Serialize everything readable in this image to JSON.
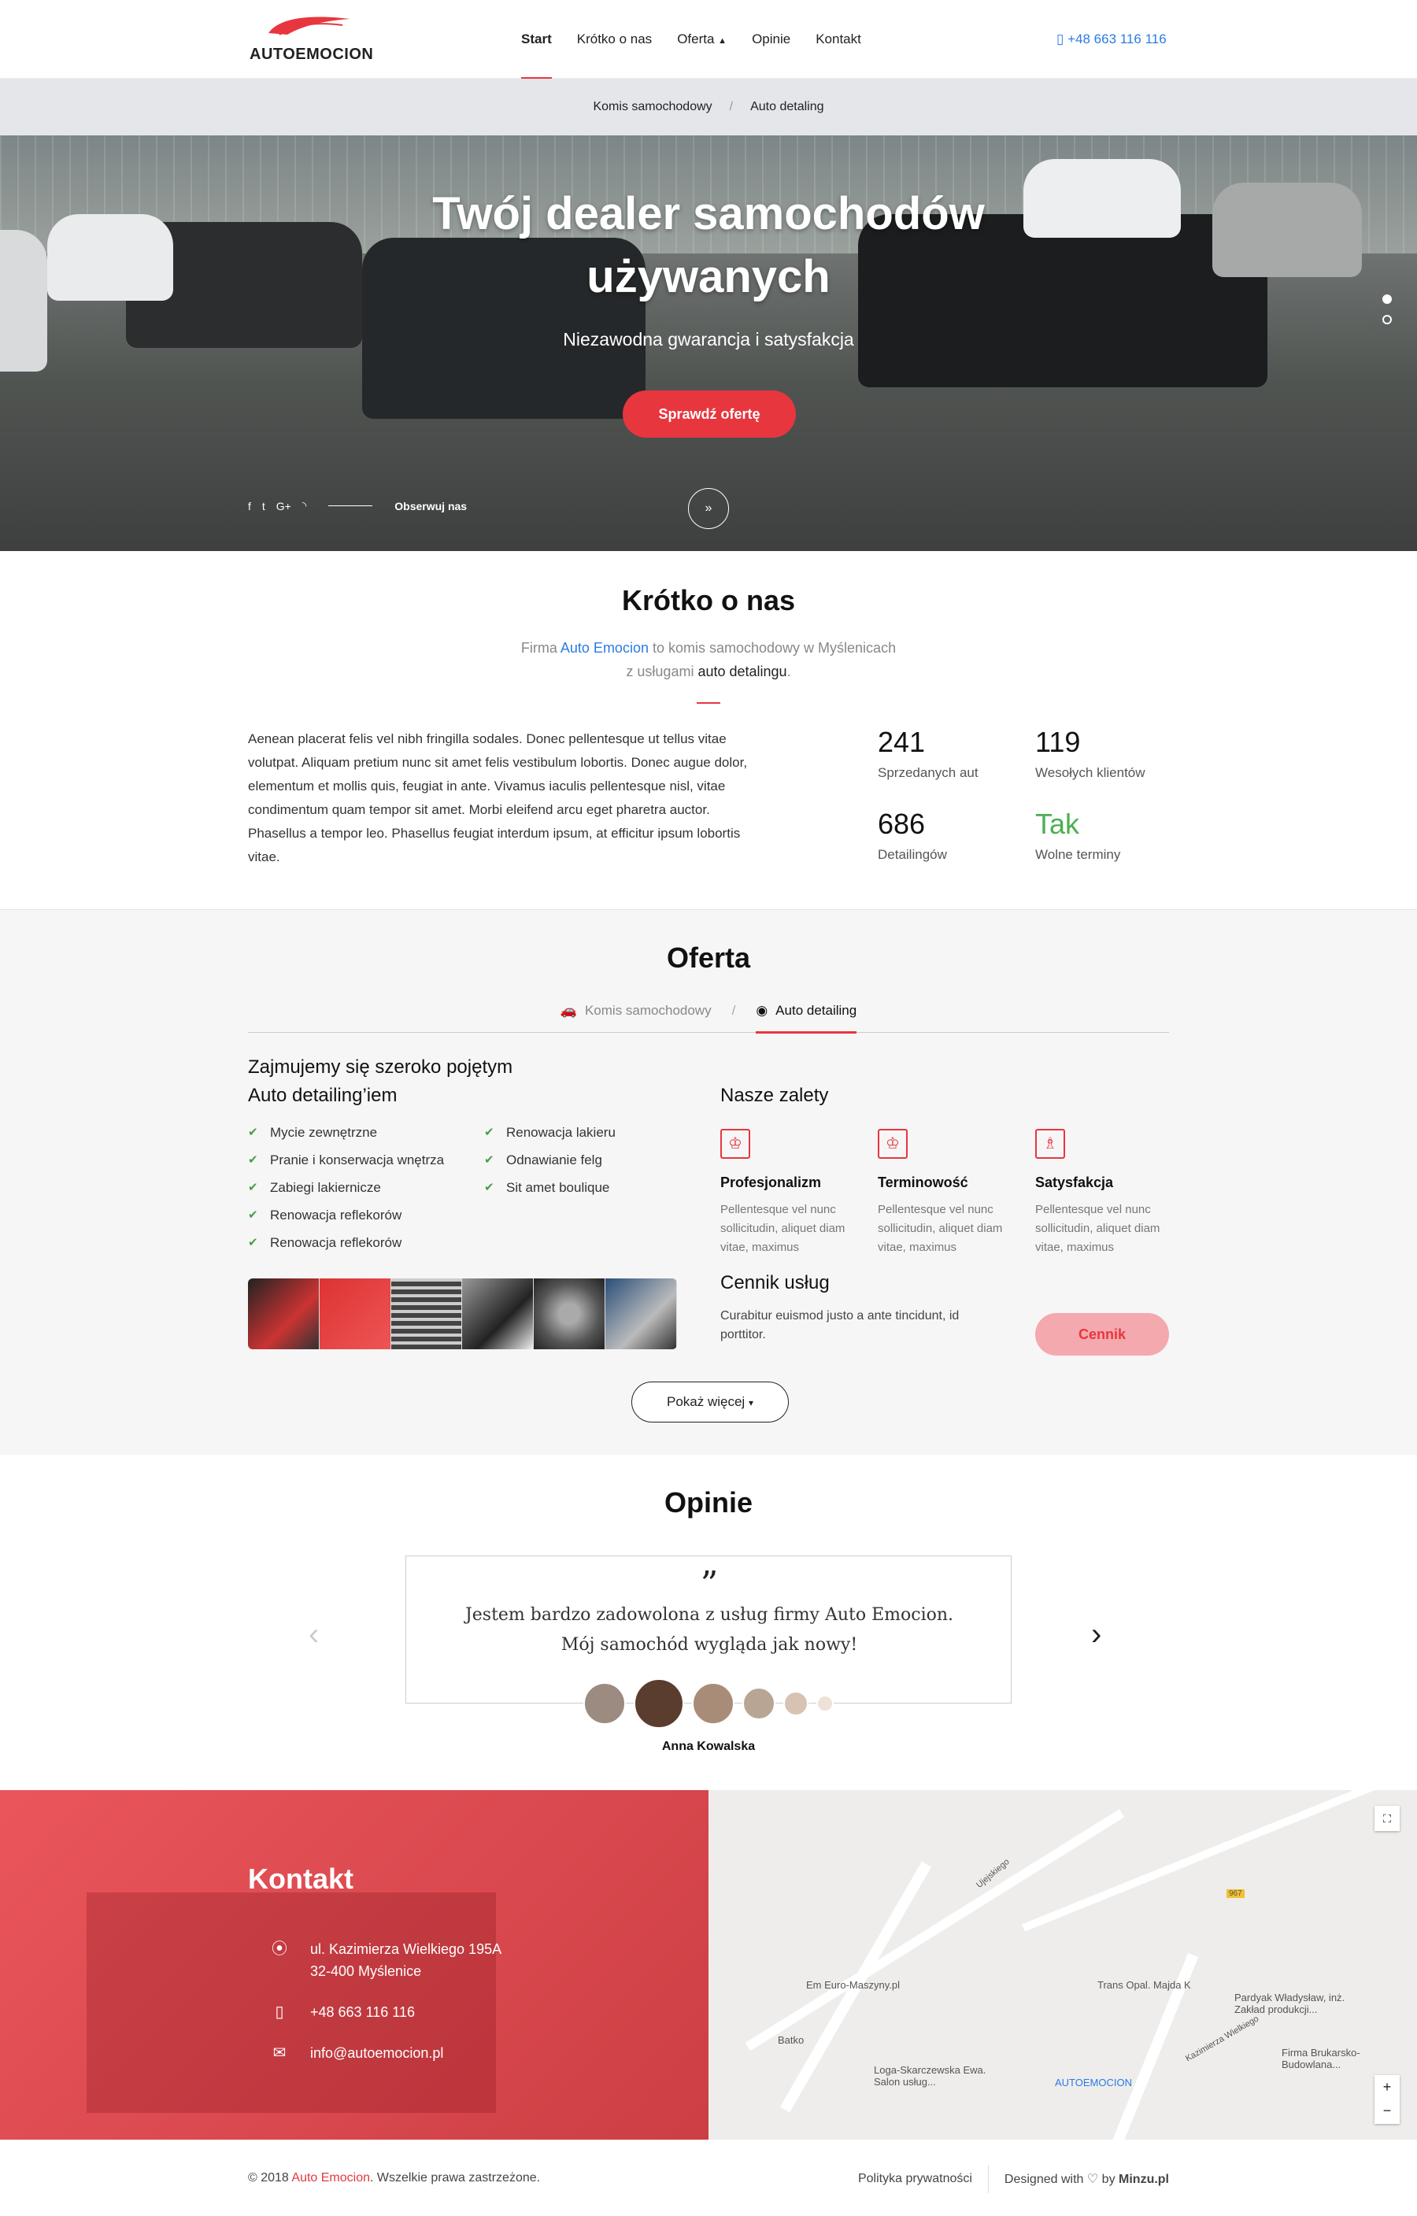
{
  "brand": {
    "name": "AUTOEMOCION",
    "accent": "#e8363f",
    "link": "#2a7be4"
  },
  "nav": {
    "items": [
      "Start",
      "Krótko o nas",
      "Oferta",
      "Opinie",
      "Kontakt"
    ],
    "active": "Start",
    "oferta_caret": "chevron-up-icon",
    "phone": "+48 663 116 116"
  },
  "crumbs": [
    "Komis samochodowy",
    "/",
    "Auto detaling"
  ],
  "hero": {
    "title_line1": "Twój dealer samochodów",
    "title_line2": "używanych",
    "subtitle": "Niezawodna gwarancja i satysfakcja",
    "cta": "Sprawdź ofertę",
    "follow": "Obserwuj nas",
    "social_icons": [
      "facebook-icon",
      "twitter-icon",
      "google-plus-icon",
      "rss-icon"
    ],
    "slides": 2,
    "active_slide": 1
  },
  "about": {
    "title": "Krótko o nas",
    "lead_1a": "Firma ",
    "lead_1b": "Auto Emocion",
    "lead_1c": " to komis samochodowy w Myślenicach",
    "lead_2a": "z usługami ",
    "lead_2b": "auto detalingu",
    "lead_2c": ".",
    "text": "Aenean placerat felis vel nibh fringilla sodales. Donec pellentesque ut tellus vitae volutpat. Aliquam pretium nunc sit amet felis vestibulum lobortis. Donec augue dolor, elementum et mollis quis, feugiat in ante. Vivamus iaculis pellentesque nisl, vitae condimentum quam tempor sit amet. Morbi eleifend arcu eget pharetra auctor. Phasellus a tempor leo. Phasellus feugiat interdum ipsum, at efficitur ipsum lobortis vitae.",
    "stats": [
      {
        "value": "241",
        "label": "Sprzedanych aut"
      },
      {
        "value": "119",
        "label": "Wesołych klientów"
      },
      {
        "value": "686",
        "label": "Detailingów"
      },
      {
        "value": "Tak",
        "label": "Wolne terminy"
      }
    ]
  },
  "offer": {
    "title": "Oferta",
    "tabs": [
      "Komis samochodowy",
      "Auto detailing"
    ],
    "active_tab": "Auto detailing",
    "heading_1": "Zajmujemy się szeroko pojętym",
    "heading_2": "Auto detailing’iem",
    "services": [
      "Mycie zewnętrzne",
      "Renowacja lakieru",
      "Pranie i konserwacja wnętrza",
      "Odnawianie felg",
      "Zabiegi lakiernicze",
      "Sit amet boulique",
      "Renowacja reflekorów",
      "",
      "Renowacja reflekorów",
      ""
    ],
    "advantages_title": "Nasze zalety",
    "advantages": [
      {
        "title": "Profesjonalizm",
        "desc": "Pellentesque vel nunc sollicitudin, aliquet diam vitae, maximus",
        "icon": "trophy-icon"
      },
      {
        "title": "Terminowość",
        "desc": "Pellentesque vel nunc sollicitudin, aliquet diam vitae, maximus",
        "icon": "trophy-icon"
      },
      {
        "title": "Satysfakcja",
        "desc": "Pellentesque vel nunc sollicitudin, aliquet diam vitae, maximus",
        "icon": "award-icon"
      }
    ],
    "price_title": "Cennik usług",
    "price_desc": "Curabitur euismod justo a ante tincidunt, id porttitor.",
    "price_button": "Cennik",
    "more_button": "Pokaż więcej"
  },
  "reviews": {
    "title": "Opinie",
    "quote_line1": "Jestem bardzo zadowolona z usług firmy Auto Emocion.",
    "quote_line2": "Mój samochód wygląda jak nowy!",
    "author": "Anna Kowalska"
  },
  "contact": {
    "title": "Kontakt",
    "address_1": "ul. Kazimierza Wielkiego 195A",
    "address_2": "32-400 Myślenice",
    "phone": "+48 663 116 116",
    "email": "info@autoemocion.pl"
  },
  "map": {
    "labels": [
      "Em Euro-Maszyny.pl",
      "Batko",
      "Trans Opal. Majda K",
      "Pardyak Władysław, inż. Zakład produkcji...",
      "Firma Brukarsko-Budowlana...",
      "Loga-Skarczewska Ewa. Salon usług...",
      "AUTOEMOCION",
      "Ujejskiego",
      "Kazimierza Wielkiego",
      "967"
    ],
    "zoom_in": "+",
    "zoom_out": "−"
  },
  "footer": {
    "copy_a": "© 2018 ",
    "copy_b": "Auto Emocion",
    "copy_c": ". Wszelkie prawa zastrzeżone.",
    "privacy": "Polityka prywatności",
    "designed": "Designed with",
    "by": " by ",
    "author": "Minzu.pl"
  }
}
